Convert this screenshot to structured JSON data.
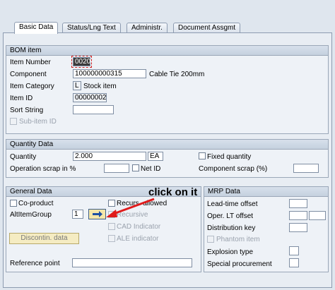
{
  "tabs": [
    "Basic Data",
    "Status/Lng Text",
    "Administr.",
    "Document Assgmt"
  ],
  "bom_item": {
    "title": "BOM item",
    "item_number_label": "Item Number",
    "item_number_value": "0020",
    "component_label": "Component",
    "component_value": "100000000315",
    "component_desc": "Cable Tie 200mm",
    "item_category_label": "Item Category",
    "item_category_value": "L",
    "item_category_desc": "Stock item",
    "item_id_label": "Item ID",
    "item_id_value": "00000002",
    "sort_string_label": "Sort String",
    "sort_string_value": "",
    "sub_item_label": "Sub-item ID"
  },
  "quantity_data": {
    "title": "Quantity Data",
    "quantity_label": "Quantity",
    "quantity_value": "2.000",
    "unit_value": "EA",
    "fixed_quantity_label": "Fixed quantity",
    "operation_scrap_label": "Operation scrap in %",
    "net_id_label": "Net ID",
    "component_scrap_label": "Component scrap (%)"
  },
  "general_data": {
    "title": "General Data",
    "co_product_label": "Co-product",
    "recurs_allowed_label": "Recurs. allowed",
    "alt_item_group_label": "AltItemGroup",
    "alt_item_group_value": "1",
    "recursive_label": "Recursive",
    "cad_indicator_label": "CAD Indicator",
    "ale_indicator_label": "ALE indicator",
    "discontin_button_label": "Discontin. data",
    "reference_point_label": "Reference point"
  },
  "mrp_data": {
    "title": "MRP Data",
    "lead_time_offset_label": "Lead-time offset",
    "oper_lt_offset_label": "Oper. LT offset",
    "distribution_key_label": "Distribution key",
    "phantom_item_label": "Phantom item",
    "explosion_type_label": "Explosion type",
    "special_procurement_label": "Special procurement"
  },
  "annotation": {
    "text": "click on it",
    "color": "#e01b1b"
  },
  "icons": {
    "arrow_button": "arrow-right-icon"
  }
}
